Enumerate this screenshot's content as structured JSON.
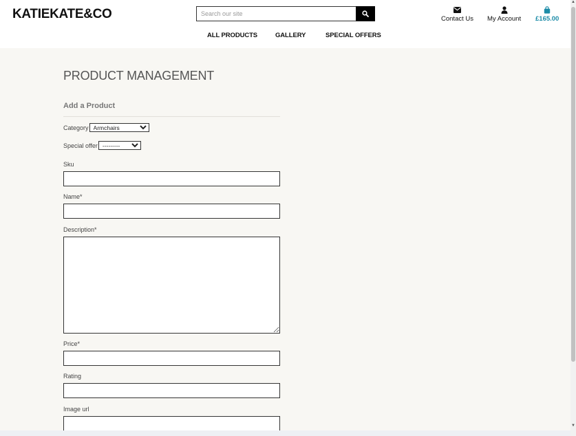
{
  "header": {
    "brand": "KATIEKATE&CO",
    "search": {
      "placeholder": "Search our site"
    },
    "links": {
      "contact": "Contact Us",
      "account": "My Account",
      "bag_total": "£165.00"
    }
  },
  "nav": {
    "items": [
      "ALL PRODUCTS",
      "GALLERY",
      "SPECIAL OFFERS"
    ]
  },
  "page": {
    "title": "PRODUCT MANAGEMENT",
    "section_title": "Add a Product"
  },
  "form": {
    "category_label": "Category",
    "category_value": "Armchairs",
    "special_offer_label": "Special offer",
    "special_offer_value": "---------",
    "sku_label": "Sku",
    "name_label": "Name*",
    "description_label": "Description*",
    "price_label": "Price*",
    "rating_label": "Rating",
    "image_url_label": "Image url"
  },
  "colors": {
    "accent": "#1d8ca8",
    "page_background": "#f8f7f3",
    "header_background": "#ffffff"
  },
  "icons": {
    "search": "search-icon",
    "contact": "envelope-icon",
    "account": "user-icon",
    "bag": "shopping-bag-icon"
  }
}
